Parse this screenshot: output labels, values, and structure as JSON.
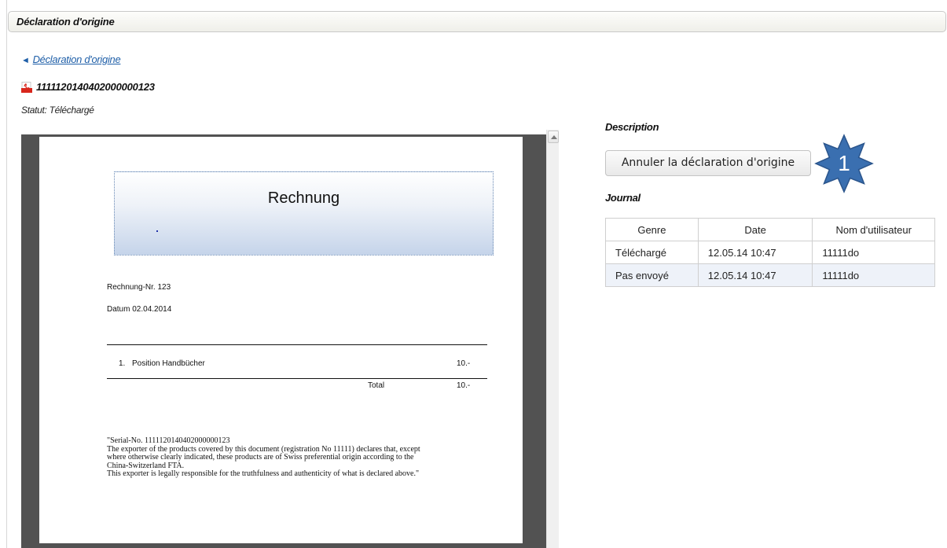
{
  "header": {
    "title": "Déclaration d'origine"
  },
  "back_link": {
    "arrow": "◄",
    "label": "Déclaration d'origine"
  },
  "document": {
    "number": "1111120140402000000123",
    "status": "Statut: Téléchargé"
  },
  "pdf": {
    "invoice_title": "Rechnung",
    "invoice_number": "Rechnung-Nr. 123",
    "invoice_date": "Datum 02.04.2014",
    "line_item_number": "1.",
    "line_item_label": "Position Handbücher",
    "line_item_amount": "10.-",
    "total_label": "Total",
    "total_amount": "10.-",
    "certification_lines": [
      "\"Serial-No. 1111120140402000000123",
      "The exporter of the products covered by this document (registration No 11111) declares that, except",
      "where otherwise clearly indicated, these products are of Swiss preferential origin according to the",
      "China-Switzerland FTA.",
      "This exporter is legally responsible for the truthfulness and authenticity of what is declared above.\""
    ]
  },
  "description": {
    "heading": "Description",
    "cancel_button": "Annuler la déclaration d'origine"
  },
  "callout": {
    "number": "1",
    "color": "#3a6fb0"
  },
  "journal": {
    "heading": "Journal",
    "columns": [
      "Genre",
      "Date",
      "Nom d'utilisateur"
    ],
    "rows": [
      [
        "Téléchargé",
        "12.05.14 10:47",
        "11111do"
      ],
      [
        "Pas envoyé",
        "12.05.14 10:47",
        "11111do"
      ]
    ]
  }
}
